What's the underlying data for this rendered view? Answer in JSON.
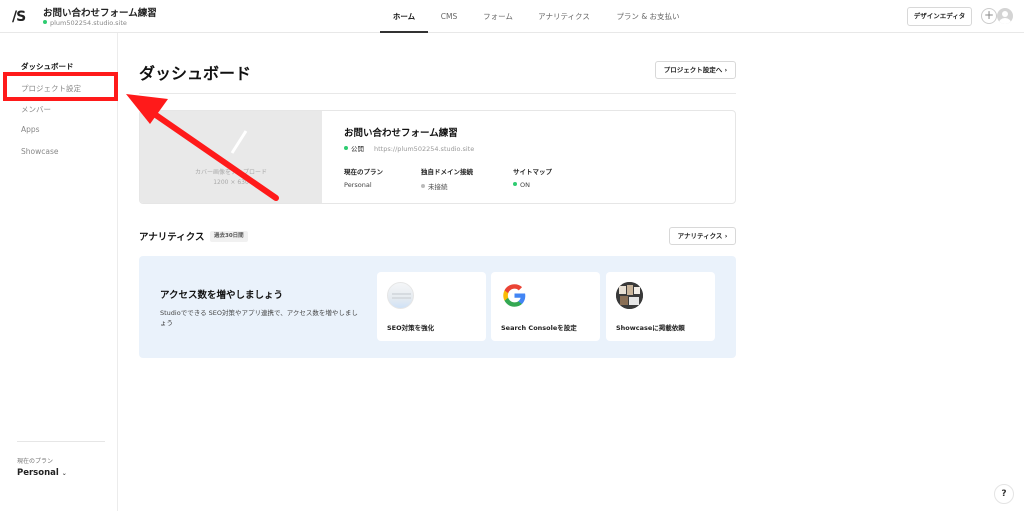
{
  "header": {
    "logo": "/S",
    "project_title": "お問い合わせフォーム練習",
    "project_url": "plum502254.studio.site",
    "tabs": [
      {
        "label": "ホーム",
        "active": true
      },
      {
        "label": "CMS",
        "active": false
      },
      {
        "label": "フォーム",
        "active": false
      },
      {
        "label": "アナリティクス",
        "active": false
      },
      {
        "label": "プラン & お支払い",
        "active": false
      }
    ],
    "design_editor_label": "デザインエディタ",
    "plus_icon": "plus-icon",
    "status_color": "#2ecc71"
  },
  "sidebar": {
    "items": [
      {
        "label": "ダッシュボード",
        "active": true
      },
      {
        "label": "プロジェクト設定",
        "active": false
      },
      {
        "label": "メンバー",
        "active": false
      },
      {
        "label": "Apps",
        "active": false
      },
      {
        "label": "Showcase",
        "active": false
      }
    ],
    "plan_label": "現在のプラン",
    "plan_value": "Personal",
    "highlight_color": "#ff1a1a"
  },
  "main": {
    "title": "ダッシュボード",
    "project_settings_button": "プロジェクト設定へ",
    "project_card": {
      "cover_text_line1": "カバー画像をアップロード",
      "cover_text_line2": "1200 × 630",
      "title": "お問い合わせフォーム練習",
      "status": "公開",
      "url": "https://plum502254.studio.site",
      "info": [
        {
          "label": "現在のプラン",
          "value": "Personal",
          "dot": "none"
        },
        {
          "label": "独自ドメイン接続",
          "value": "未接続",
          "dot": "gray"
        },
        {
          "label": "サイトマップ",
          "value": "ON",
          "dot": "green"
        }
      ]
    },
    "analytics": {
      "title": "アナリティクス",
      "badge": "過去30日間",
      "button": "アナリティクス"
    },
    "promo": {
      "title": "アクセス数を増やしましょう",
      "description": "Studioでできる SEO対策やアプリ連携で、アクセス数を増やしましょう",
      "cards": [
        {
          "label": "SEO対策を強化",
          "icon": "seo-icon"
        },
        {
          "label": "Search Consoleを設定",
          "icon": "google-icon"
        },
        {
          "label": "Showcaseに掲載依頼",
          "icon": "showcase-icon"
        }
      ]
    }
  },
  "help_label": "?"
}
